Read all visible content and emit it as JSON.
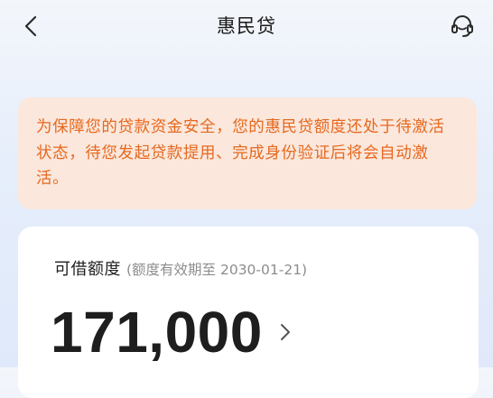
{
  "nav": {
    "title": "惠民贷",
    "back_icon": "chevron-left-icon",
    "service_icon": "headset-icon"
  },
  "notice": {
    "text": "为保障您的贷款资金安全，您的惠民贷额度还处于待激活状态，待您发起贷款提用、完成身份验证后将会自动激活。",
    "text_color": "#e6691f",
    "background_color": "#fbe7dc"
  },
  "credit": {
    "label": "可借额度",
    "validity": "(额度有效期至 2030-01-21)",
    "amount": "171,000",
    "detail_icon": "chevron-right-icon"
  }
}
